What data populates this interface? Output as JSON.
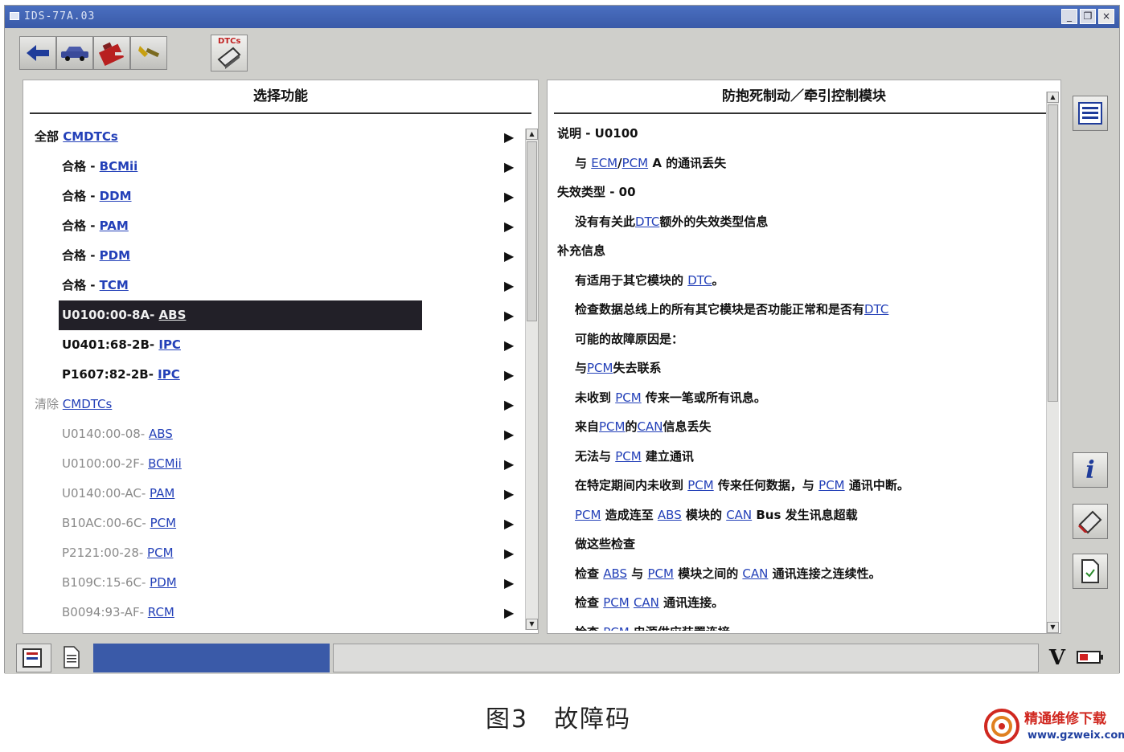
{
  "window": {
    "title": "IDS-77A.03",
    "min": "_",
    "restore": "❐",
    "close": "×"
  },
  "toolbar": {
    "dtc_label": "DTCs"
  },
  "left_panel": {
    "title": "选择功能",
    "rows": [
      {
        "prefix": "全部 ",
        "link": "CMDTCs",
        "style": "bold",
        "indent": 14
      },
      {
        "prefix": "合格 - ",
        "link": "BCMii",
        "style": "bold",
        "indent": 48
      },
      {
        "prefix": "合格 - ",
        "link": "DDM",
        "style": "bold",
        "indent": 48
      },
      {
        "prefix": "合格 - ",
        "link": "PAM",
        "style": "bold",
        "indent": 48
      },
      {
        "prefix": "合格 - ",
        "link": "PDM",
        "style": "bold",
        "indent": 48
      },
      {
        "prefix": "合格 - ",
        "link": "TCM",
        "style": "bold",
        "indent": 48
      },
      {
        "prefix": "U0100:00-8A- ",
        "link": "ABS",
        "style": "selected",
        "indent": 48
      },
      {
        "prefix": "U0401:68-2B- ",
        "link": "IPC",
        "style": "bold",
        "indent": 48
      },
      {
        "prefix": "P1607:82-2B- ",
        "link": "IPC",
        "style": "bold",
        "indent": 48
      },
      {
        "prefix": "清除 ",
        "link": "CMDTCs",
        "style": "grey",
        "indent": 14
      },
      {
        "prefix": "U0140:00-08- ",
        "link": "ABS",
        "style": "grey",
        "indent": 48
      },
      {
        "prefix": "U0100:00-2F- ",
        "link": "BCMii",
        "style": "grey",
        "indent": 48
      },
      {
        "prefix": "U0140:00-AC- ",
        "link": "PAM",
        "style": "grey",
        "indent": 48
      },
      {
        "prefix": "B10AC:00-6C- ",
        "link": "PCM",
        "style": "grey",
        "indent": 48
      },
      {
        "prefix": "P2121:00-28- ",
        "link": "PCM",
        "style": "grey",
        "indent": 48
      },
      {
        "prefix": "B109C:15-6C- ",
        "link": "PDM",
        "style": "grey",
        "indent": 48
      },
      {
        "prefix": "B0094:93-AF- ",
        "link": "RCM",
        "style": "grey",
        "indent": 48
      }
    ],
    "arrow": "▶"
  },
  "right_panel": {
    "title": "防抱死制动／牵引控制模块",
    "lines": [
      {
        "indent": 12,
        "parts": [
          {
            "t": "说明 - U0100"
          }
        ]
      },
      {
        "indent": 34,
        "parts": [
          {
            "t": "与 "
          },
          {
            "t": "ECM",
            "link": true
          },
          {
            "t": "/"
          },
          {
            "t": "PCM",
            "link": true
          },
          {
            "t": " A 的通讯丢失"
          }
        ]
      },
      {
        "indent": 12,
        "parts": [
          {
            "t": "失效类型 - 00"
          }
        ]
      },
      {
        "indent": 34,
        "parts": [
          {
            "t": "没有有关此"
          },
          {
            "t": "DTC",
            "link": true
          },
          {
            "t": "额外的失效类型信息"
          }
        ]
      },
      {
        "indent": 12,
        "parts": [
          {
            "t": "补充信息"
          }
        ]
      },
      {
        "indent": 34,
        "parts": [
          {
            "t": "有适用于其它模块的 "
          },
          {
            "t": "DTC",
            "link": true
          },
          {
            "t": "。"
          }
        ]
      },
      {
        "indent": 34,
        "parts": [
          {
            "t": "检查数据总线上的所有其它模块是否功能正常和是否有"
          },
          {
            "t": "DTC",
            "link": true
          }
        ]
      },
      {
        "indent": 34,
        "parts": [
          {
            "t": "可能的故障原因是："
          }
        ]
      },
      {
        "indent": 34,
        "parts": [
          {
            "t": "与"
          },
          {
            "t": "PCM",
            "link": true
          },
          {
            "t": "失去联系"
          }
        ]
      },
      {
        "indent": 34,
        "parts": [
          {
            "t": "未收到 "
          },
          {
            "t": "PCM",
            "link": true
          },
          {
            "t": " 传来一笔或所有讯息。"
          }
        ]
      },
      {
        "indent": 34,
        "parts": [
          {
            "t": "来自"
          },
          {
            "t": "PCM",
            "link": true
          },
          {
            "t": "的"
          },
          {
            "t": "CAN",
            "link": true
          },
          {
            "t": "信息丢失"
          }
        ]
      },
      {
        "indent": 34,
        "parts": [
          {
            "t": "无法与 "
          },
          {
            "t": "PCM",
            "link": true
          },
          {
            "t": " 建立通讯"
          }
        ]
      },
      {
        "indent": 34,
        "parts": [
          {
            "t": "在特定期间内未收到 "
          },
          {
            "t": "PCM",
            "link": true
          },
          {
            "t": " 传来任何数据，与 "
          },
          {
            "t": "PCM",
            "link": true
          },
          {
            "t": " 通讯中断。"
          }
        ]
      },
      {
        "indent": 34,
        "parts": [
          {
            "t": "PCM",
            "link": true
          },
          {
            "t": " 造成连至 "
          },
          {
            "t": "ABS",
            "link": true
          },
          {
            "t": " 模块的 "
          },
          {
            "t": "CAN",
            "link": true
          },
          {
            "t": " Bus 发生讯息超载"
          }
        ]
      },
      {
        "indent": 34,
        "parts": [
          {
            "t": "做这些检查"
          }
        ]
      },
      {
        "indent": 34,
        "parts": [
          {
            "t": "检查 "
          },
          {
            "t": "ABS",
            "link": true
          },
          {
            "t": " 与 "
          },
          {
            "t": "PCM",
            "link": true
          },
          {
            "t": " 模块之间的 "
          },
          {
            "t": "CAN",
            "link": true
          },
          {
            "t": " 通讯连接之连续性。"
          }
        ]
      },
      {
        "indent": 34,
        "parts": [
          {
            "t": "检查 "
          },
          {
            "t": "PCM",
            "link": true
          },
          {
            "t": " "
          },
          {
            "t": "CAN",
            "link": true
          },
          {
            "t": " 通讯连接。"
          }
        ]
      },
      {
        "indent": 34,
        "parts": [
          {
            "t": "检查 "
          },
          {
            "t": "PCM",
            "link": true
          },
          {
            "t": " 电源供应装置连接"
          }
        ]
      }
    ]
  },
  "side_buttons": {
    "info_glyph": "i"
  },
  "statusbar": {
    "version_glyph": "V"
  },
  "caption": "图3　故障码",
  "watermark": {
    "name": "精通维修下载",
    "url": "www.gzweix.com"
  },
  "colors": {
    "link": "#2340b8",
    "title_bar": "#3a5aa8",
    "selection": "#222028"
  }
}
